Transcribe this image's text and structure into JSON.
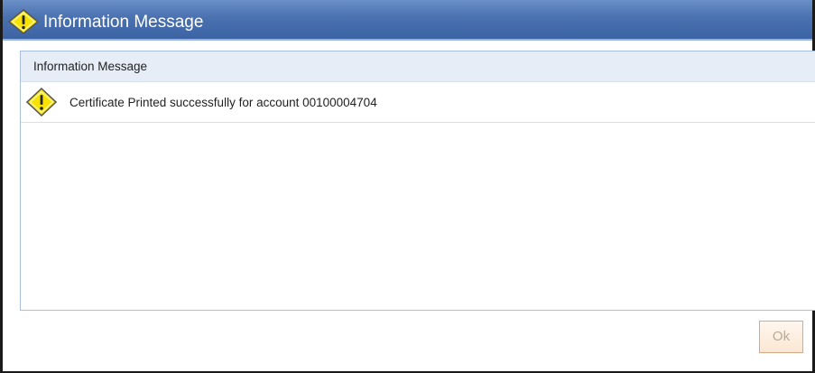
{
  "window": {
    "title": "Information Message",
    "title_icon": "warning-diamond-icon"
  },
  "panel": {
    "header": "Information Message",
    "messages": [
      {
        "icon": "warning-diamond-icon",
        "text": "Certificate Printed successfully for account 00100004704"
      }
    ]
  },
  "footer": {
    "ok_label": "Ok"
  },
  "colors": {
    "titlebar": "#4a71b0",
    "panel_header": "#e6edf7",
    "warning_fill": "#f7e200",
    "ok_border": "#d7a985"
  }
}
